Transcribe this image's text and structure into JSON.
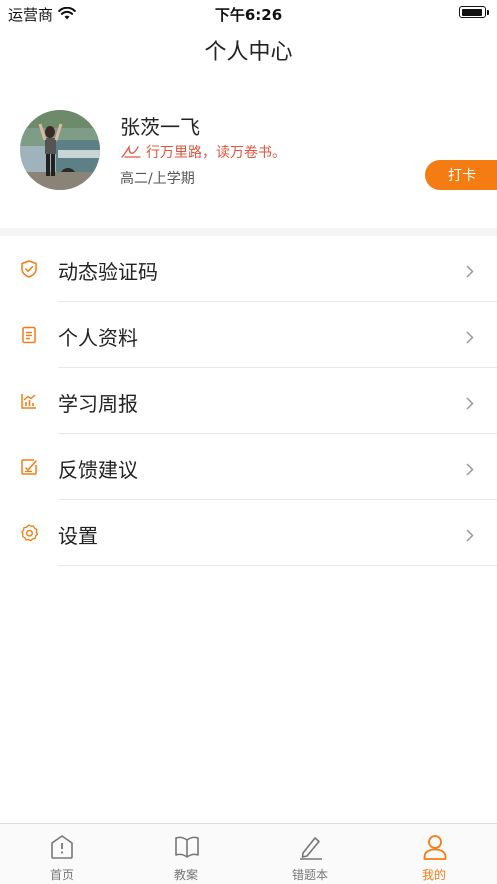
{
  "status_bar": {
    "carrier": "运营商",
    "time": "下午6:26"
  },
  "header": {
    "title": "个人中心"
  },
  "profile": {
    "name": "张茨一飞",
    "motto": "行万里路，读万卷书。",
    "grade": "高二/上学期",
    "checkin_label": "打卡"
  },
  "menu": {
    "items": [
      {
        "label": "动态验证码",
        "icon": "shield-check-icon"
      },
      {
        "label": "个人资料",
        "icon": "document-icon"
      },
      {
        "label": "学习周报",
        "icon": "chart-icon"
      },
      {
        "label": "反馈建议",
        "icon": "edit-icon"
      },
      {
        "label": "设置",
        "icon": "gear-icon"
      }
    ]
  },
  "tab_bar": {
    "tabs": [
      {
        "label": "首页",
        "icon": "home-icon",
        "active": false
      },
      {
        "label": "教案",
        "icon": "book-icon",
        "active": false
      },
      {
        "label": "错题本",
        "icon": "pencil-icon",
        "active": false
      },
      {
        "label": "我的",
        "icon": "user-icon",
        "active": true
      }
    ]
  },
  "colors": {
    "accent": "#f57c13",
    "motto": "#e0533e"
  }
}
